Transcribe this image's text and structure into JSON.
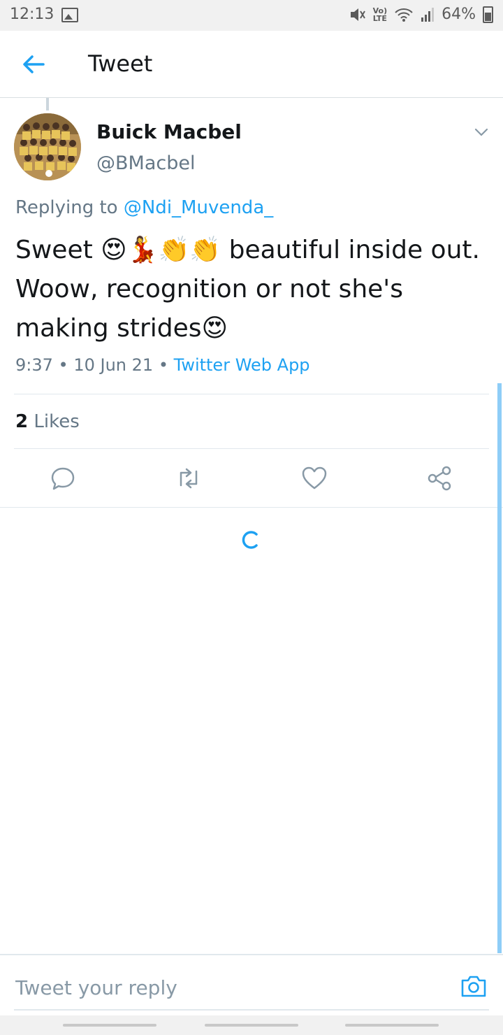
{
  "status_bar": {
    "time": "12:13",
    "lte": "LTE",
    "volte": "Vo)",
    "battery": "64%"
  },
  "app_bar": {
    "title": "Tweet"
  },
  "tweet": {
    "author_name": "Buick Macbel",
    "author_handle": "@BMacbel",
    "replying_prefix": "Replying to",
    "replying_handle": "@Ndi_Muvenda_",
    "text": "Sweet 😍💃👏👏 beautiful inside out. Woow, recognition or not she's making strides😍",
    "time": "9:37",
    "separator": "•",
    "date": "10 Jun 21",
    "source": "Twitter Web App",
    "likes_count": "2",
    "likes_label": "Likes"
  },
  "reply": {
    "placeholder": "Tweet your reply"
  },
  "colors": {
    "accent": "#1da1f2",
    "secondary_text": "#657786",
    "primary_text": "#14171a",
    "divider": "#e1e8ed"
  }
}
